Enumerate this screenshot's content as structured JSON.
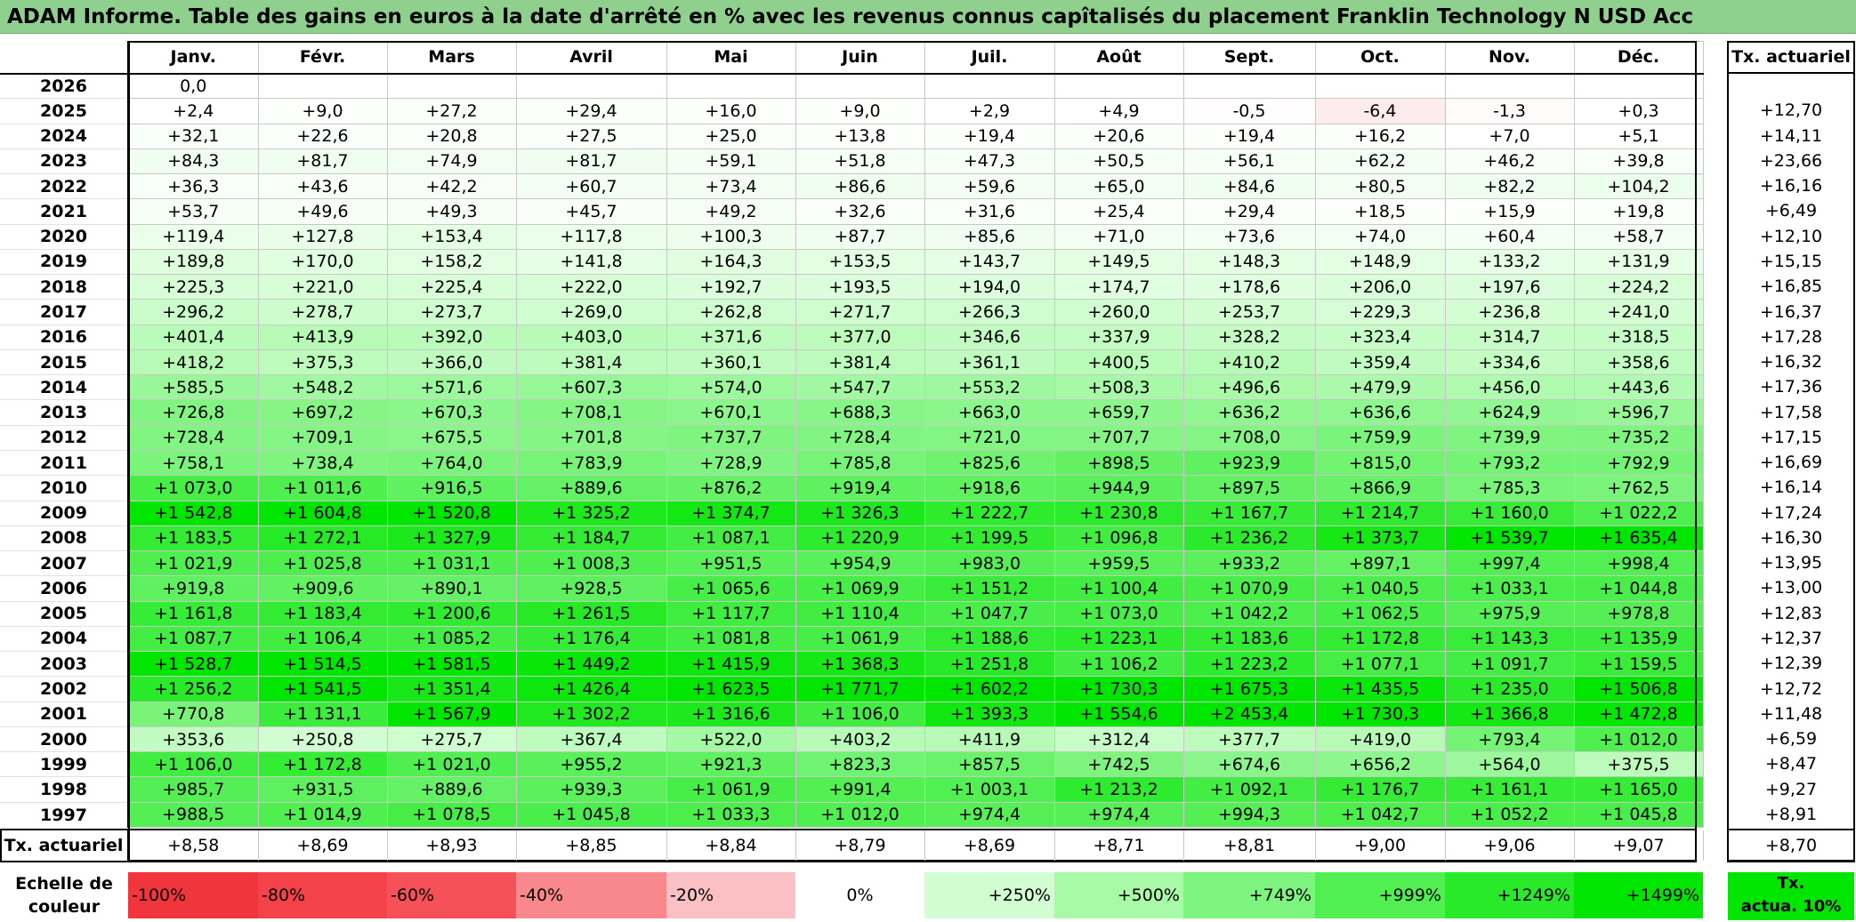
{
  "title": "ADAM Informe. Table des gains en euros à la date d'arrêté en % avec les revenus connus capîtalisés du placement Franklin Technology N USD Acc",
  "chart_data": {
    "type": "table",
    "title": "ADAM Informe. Table des gains en euros à la date d'arrêté en % avec les revenus connus capîtalisés du placement Franklin Technology N USD Acc",
    "columns": [
      "Janv.",
      "Févr.",
      "Mars",
      "Avril",
      "Mai",
      "Juin",
      "Juil.",
      "Août",
      "Sept.",
      "Oct.",
      "Nov.",
      "Déc."
    ],
    "rate_header": "Tx. actuariel",
    "rows": [
      {
        "year": "2026",
        "values": [
          "0,0",
          "",
          "",
          "",
          "",
          "",
          "",
          "",
          "",
          "",
          "",
          ""
        ],
        "num": [
          0,
          null,
          null,
          null,
          null,
          null,
          null,
          null,
          null,
          null,
          null,
          null
        ],
        "rate": ""
      },
      {
        "year": "2025",
        "values": [
          "+2,4",
          "+9,0",
          "+27,2",
          "+29,4",
          "+16,0",
          "+9,0",
          "+2,9",
          "+4,9",
          "-0,5",
          "-6,4",
          "-1,3",
          "+0,3"
        ],
        "num": [
          2.4,
          9.0,
          27.2,
          29.4,
          16.0,
          9.0,
          2.9,
          4.9,
          -0.5,
          -6.4,
          -1.3,
          0.3
        ],
        "rate": "+12,70"
      },
      {
        "year": "2024",
        "values": [
          "+32,1",
          "+22,6",
          "+20,8",
          "+27,5",
          "+25,0",
          "+13,8",
          "+19,4",
          "+20,6",
          "+19,4",
          "+16,2",
          "+7,0",
          "+5,1"
        ],
        "num": [
          32.1,
          22.6,
          20.8,
          27.5,
          25.0,
          13.8,
          19.4,
          20.6,
          19.4,
          16.2,
          7.0,
          5.1
        ],
        "rate": "+14,11"
      },
      {
        "year": "2023",
        "values": [
          "+84,3",
          "+81,7",
          "+74,9",
          "+81,7",
          "+59,1",
          "+51,8",
          "+47,3",
          "+50,5",
          "+56,1",
          "+62,2",
          "+46,2",
          "+39,8"
        ],
        "num": [
          84.3,
          81.7,
          74.9,
          81.7,
          59.1,
          51.8,
          47.3,
          50.5,
          56.1,
          62.2,
          46.2,
          39.8
        ],
        "rate": "+23,66"
      },
      {
        "year": "2022",
        "values": [
          "+36,3",
          "+43,6",
          "+42,2",
          "+60,7",
          "+73,4",
          "+86,6",
          "+59,6",
          "+65,0",
          "+84,6",
          "+80,5",
          "+82,2",
          "+104,2"
        ],
        "num": [
          36.3,
          43.6,
          42.2,
          60.7,
          73.4,
          86.6,
          59.6,
          65.0,
          84.6,
          80.5,
          82.2,
          104.2
        ],
        "rate": "+16,16"
      },
      {
        "year": "2021",
        "values": [
          "+53,7",
          "+49,6",
          "+49,3",
          "+45,7",
          "+49,2",
          "+32,6",
          "+31,6",
          "+25,4",
          "+29,4",
          "+18,5",
          "+15,9",
          "+19,8"
        ],
        "num": [
          53.7,
          49.6,
          49.3,
          45.7,
          49.2,
          32.6,
          31.6,
          25.4,
          29.4,
          18.5,
          15.9,
          19.8
        ],
        "rate": "+6,49"
      },
      {
        "year": "2020",
        "values": [
          "+119,4",
          "+127,8",
          "+153,4",
          "+117,8",
          "+100,3",
          "+87,7",
          "+85,6",
          "+71,0",
          "+73,6",
          "+74,0",
          "+60,4",
          "+58,7"
        ],
        "num": [
          119.4,
          127.8,
          153.4,
          117.8,
          100.3,
          87.7,
          85.6,
          71.0,
          73.6,
          74.0,
          60.4,
          58.7
        ],
        "rate": "+12,10"
      },
      {
        "year": "2019",
        "values": [
          "+189,8",
          "+170,0",
          "+158,2",
          "+141,8",
          "+164,3",
          "+153,5",
          "+143,7",
          "+149,5",
          "+148,3",
          "+148,9",
          "+133,2",
          "+131,9"
        ],
        "num": [
          189.8,
          170.0,
          158.2,
          141.8,
          164.3,
          153.5,
          143.7,
          149.5,
          148.3,
          148.9,
          133.2,
          131.9
        ],
        "rate": "+15,15"
      },
      {
        "year": "2018",
        "values": [
          "+225,3",
          "+221,0",
          "+225,4",
          "+222,0",
          "+192,7",
          "+193,5",
          "+194,0",
          "+174,7",
          "+178,6",
          "+206,0",
          "+197,6",
          "+224,2"
        ],
        "num": [
          225.3,
          221.0,
          225.4,
          222.0,
          192.7,
          193.5,
          194.0,
          174.7,
          178.6,
          206.0,
          197.6,
          224.2
        ],
        "rate": "+16,85"
      },
      {
        "year": "2017",
        "values": [
          "+296,2",
          "+278,7",
          "+273,7",
          "+269,0",
          "+262,8",
          "+271,7",
          "+266,3",
          "+260,0",
          "+253,7",
          "+229,3",
          "+236,8",
          "+241,0"
        ],
        "num": [
          296.2,
          278.7,
          273.7,
          269.0,
          262.8,
          271.7,
          266.3,
          260.0,
          253.7,
          229.3,
          236.8,
          241.0
        ],
        "rate": "+16,37"
      },
      {
        "year": "2016",
        "values": [
          "+401,4",
          "+413,9",
          "+392,0",
          "+403,0",
          "+371,6",
          "+377,0",
          "+346,6",
          "+337,9",
          "+328,2",
          "+323,4",
          "+314,7",
          "+318,5"
        ],
        "num": [
          401.4,
          413.9,
          392.0,
          403.0,
          371.6,
          377.0,
          346.6,
          337.9,
          328.2,
          323.4,
          314.7,
          318.5
        ],
        "rate": "+17,28"
      },
      {
        "year": "2015",
        "values": [
          "+418,2",
          "+375,3",
          "+366,0",
          "+381,4",
          "+360,1",
          "+381,4",
          "+361,1",
          "+400,5",
          "+410,2",
          "+359,4",
          "+334,6",
          "+358,6"
        ],
        "num": [
          418.2,
          375.3,
          366.0,
          381.4,
          360.1,
          381.4,
          361.1,
          400.5,
          410.2,
          359.4,
          334.6,
          358.6
        ],
        "rate": "+16,32"
      },
      {
        "year": "2014",
        "values": [
          "+585,5",
          "+548,2",
          "+571,6",
          "+607,3",
          "+574,0",
          "+547,7",
          "+553,2",
          "+508,3",
          "+496,6",
          "+479,9",
          "+456,0",
          "+443,6"
        ],
        "num": [
          585.5,
          548.2,
          571.6,
          607.3,
          574.0,
          547.7,
          553.2,
          508.3,
          496.6,
          479.9,
          456.0,
          443.6
        ],
        "rate": "+17,36"
      },
      {
        "year": "2013",
        "values": [
          "+726,8",
          "+697,2",
          "+670,3",
          "+708,1",
          "+670,1",
          "+688,3",
          "+663,0",
          "+659,7",
          "+636,2",
          "+636,6",
          "+624,9",
          "+596,7"
        ],
        "num": [
          726.8,
          697.2,
          670.3,
          708.1,
          670.1,
          688.3,
          663.0,
          659.7,
          636.2,
          636.6,
          624.9,
          596.7
        ],
        "rate": "+17,58"
      },
      {
        "year": "2012",
        "values": [
          "+728,4",
          "+709,1",
          "+675,5",
          "+701,8",
          "+737,7",
          "+728,4",
          "+721,0",
          "+707,7",
          "+708,0",
          "+759,9",
          "+739,9",
          "+735,2"
        ],
        "num": [
          728.4,
          709.1,
          675.5,
          701.8,
          737.7,
          728.4,
          721.0,
          707.7,
          708.0,
          759.9,
          739.9,
          735.2
        ],
        "rate": "+17,15"
      },
      {
        "year": "2011",
        "values": [
          "+758,1",
          "+738,4",
          "+764,0",
          "+783,9",
          "+728,9",
          "+785,8",
          "+825,6",
          "+898,5",
          "+923,9",
          "+815,0",
          "+793,2",
          "+792,9"
        ],
        "num": [
          758.1,
          738.4,
          764.0,
          783.9,
          728.9,
          785.8,
          825.6,
          898.5,
          923.9,
          815.0,
          793.2,
          792.9
        ],
        "rate": "+16,69"
      },
      {
        "year": "2010",
        "values": [
          "+1 073,0",
          "+1 011,6",
          "+916,5",
          "+889,6",
          "+876,2",
          "+919,4",
          "+918,6",
          "+944,9",
          "+897,5",
          "+866,9",
          "+785,3",
          "+762,5"
        ],
        "num": [
          1073.0,
          1011.6,
          916.5,
          889.6,
          876.2,
          919.4,
          918.6,
          944.9,
          897.5,
          866.9,
          785.3,
          762.5
        ],
        "rate": "+16,14"
      },
      {
        "year": "2009",
        "values": [
          "+1 542,8",
          "+1 604,8",
          "+1 520,8",
          "+1 325,2",
          "+1 374,7",
          "+1 326,3",
          "+1 222,7",
          "+1 230,8",
          "+1 167,7",
          "+1 214,7",
          "+1 160,0",
          "+1 022,2"
        ],
        "num": [
          1542.8,
          1604.8,
          1520.8,
          1325.2,
          1374.7,
          1326.3,
          1222.7,
          1230.8,
          1167.7,
          1214.7,
          1160.0,
          1022.2
        ],
        "rate": "+17,24"
      },
      {
        "year": "2008",
        "values": [
          "+1 183,5",
          "+1 272,1",
          "+1 327,9",
          "+1 184,7",
          "+1 087,1",
          "+1 220,9",
          "+1 199,5",
          "+1 096,8",
          "+1 236,2",
          "+1 373,7",
          "+1 539,7",
          "+1 635,4"
        ],
        "num": [
          1183.5,
          1272.1,
          1327.9,
          1184.7,
          1087.1,
          1220.9,
          1199.5,
          1096.8,
          1236.2,
          1373.7,
          1539.7,
          1635.4
        ],
        "rate": "+16,30"
      },
      {
        "year": "2007",
        "values": [
          "+1 021,9",
          "+1 025,8",
          "+1 031,1",
          "+1 008,3",
          "+951,5",
          "+954,9",
          "+983,0",
          "+959,5",
          "+933,2",
          "+897,1",
          "+997,4",
          "+998,4"
        ],
        "num": [
          1021.9,
          1025.8,
          1031.1,
          1008.3,
          951.5,
          954.9,
          983.0,
          959.5,
          933.2,
          897.1,
          997.4,
          998.4
        ],
        "rate": "+13,95"
      },
      {
        "year": "2006",
        "values": [
          "+919,8",
          "+909,6",
          "+890,1",
          "+928,5",
          "+1 065,6",
          "+1 069,9",
          "+1 151,2",
          "+1 100,4",
          "+1 070,9",
          "+1 040,5",
          "+1 033,1",
          "+1 044,8"
        ],
        "num": [
          919.8,
          909.6,
          890.1,
          928.5,
          1065.6,
          1069.9,
          1151.2,
          1100.4,
          1070.9,
          1040.5,
          1033.1,
          1044.8
        ],
        "rate": "+13,00"
      },
      {
        "year": "2005",
        "values": [
          "+1 161,8",
          "+1 183,4",
          "+1 200,6",
          "+1 261,5",
          "+1 117,7",
          "+1 110,4",
          "+1 047,7",
          "+1 073,0",
          "+1 042,2",
          "+1 062,5",
          "+975,9",
          "+978,8"
        ],
        "num": [
          1161.8,
          1183.4,
          1200.6,
          1261.5,
          1117.7,
          1110.4,
          1047.7,
          1073.0,
          1042.2,
          1062.5,
          975.9,
          978.8
        ],
        "rate": "+12,83"
      },
      {
        "year": "2004",
        "values": [
          "+1 087,7",
          "+1 106,4",
          "+1 085,2",
          "+1 176,4",
          "+1 081,8",
          "+1 061,9",
          "+1 188,6",
          "+1 223,1",
          "+1 183,6",
          "+1 172,8",
          "+1 143,3",
          "+1 135,9"
        ],
        "num": [
          1087.7,
          1106.4,
          1085.2,
          1176.4,
          1081.8,
          1061.9,
          1188.6,
          1223.1,
          1183.6,
          1172.8,
          1143.3,
          1135.9
        ],
        "rate": "+12,37"
      },
      {
        "year": "2003",
        "values": [
          "+1 528,7",
          "+1 514,5",
          "+1 581,5",
          "+1 449,2",
          "+1 415,9",
          "+1 368,3",
          "+1 251,8",
          "+1 106,2",
          "+1 223,2",
          "+1 077,1",
          "+1 091,7",
          "+1 159,5"
        ],
        "num": [
          1528.7,
          1514.5,
          1581.5,
          1449.2,
          1415.9,
          1368.3,
          1251.8,
          1106.2,
          1223.2,
          1077.1,
          1091.7,
          1159.5
        ],
        "rate": "+12,39"
      },
      {
        "year": "2002",
        "values": [
          "+1 256,2",
          "+1 541,5",
          "+1 351,4",
          "+1 426,4",
          "+1 623,5",
          "+1 771,7",
          "+1 602,2",
          "+1 730,3",
          "+1 675,3",
          "+1 435,5",
          "+1 235,0",
          "+1 506,8"
        ],
        "num": [
          1256.2,
          1541.5,
          1351.4,
          1426.4,
          1623.5,
          1771.7,
          1602.2,
          1730.3,
          1675.3,
          1435.5,
          1235.0,
          1506.8
        ],
        "rate": "+12,72"
      },
      {
        "year": "2001",
        "values": [
          "+770,8",
          "+1 131,1",
          "+1 567,9",
          "+1 302,2",
          "+1 316,6",
          "+1 106,0",
          "+1 393,3",
          "+1 554,6",
          "+2 453,4",
          "+1 730,3",
          "+1 366,8",
          "+1 472,8"
        ],
        "num": [
          770.8,
          1131.1,
          1567.9,
          1302.2,
          1316.6,
          1106.0,
          1393.3,
          1554.6,
          2453.4,
          1730.3,
          1366.8,
          1472.8
        ],
        "rate": "+11,48"
      },
      {
        "year": "2000",
        "values": [
          "+353,6",
          "+250,8",
          "+275,7",
          "+367,4",
          "+522,0",
          "+403,2",
          "+411,9",
          "+312,4",
          "+377,7",
          "+419,0",
          "+793,4",
          "+1 012,0"
        ],
        "num": [
          353.6,
          250.8,
          275.7,
          367.4,
          522.0,
          403.2,
          411.9,
          312.4,
          377.7,
          419.0,
          793.4,
          1012.0
        ],
        "rate": "+6,59"
      },
      {
        "year": "1999",
        "values": [
          "+1 106,0",
          "+1 172,8",
          "+1 021,0",
          "+955,2",
          "+921,3",
          "+823,3",
          "+857,5",
          "+742,5",
          "+674,6",
          "+656,2",
          "+564,0",
          "+375,5"
        ],
        "num": [
          1106.0,
          1172.8,
          1021.0,
          955.2,
          921.3,
          823.3,
          857.5,
          742.5,
          674.6,
          656.2,
          564.0,
          375.5
        ],
        "rate": "+8,47"
      },
      {
        "year": "1998",
        "values": [
          "+985,7",
          "+931,5",
          "+889,6",
          "+939,3",
          "+1 061,9",
          "+991,4",
          "+1 003,1",
          "+1 213,2",
          "+1 092,1",
          "+1 176,7",
          "+1 161,1",
          "+1 165,0"
        ],
        "num": [
          985.7,
          931.5,
          889.6,
          939.3,
          1061.9,
          991.4,
          1003.1,
          1213.2,
          1092.1,
          1176.7,
          1161.1,
          1165.0
        ],
        "rate": "+9,27"
      },
      {
        "year": "1997",
        "values": [
          "+988,5",
          "+1 014,9",
          "+1 078,5",
          "+1 045,8",
          "+1 033,3",
          "+1 012,0",
          "+974,4",
          "+974,4",
          "+994,3",
          "+1 042,7",
          "+1 052,2",
          "+1 045,8"
        ],
        "num": [
          988.5,
          1014.9,
          1078.5,
          1045.8,
          1033.3,
          1012.0,
          974.4,
          974.4,
          994.3,
          1042.7,
          1052.2,
          1045.8
        ],
        "rate": "+8,91"
      }
    ],
    "rate_row": {
      "label": "Tx. actuariel",
      "values": [
        "+8,58",
        "+8,69",
        "+8,93",
        "+8,85",
        "+8,84",
        "+8,79",
        "+8,69",
        "+8,71",
        "+8,81",
        "+9,00",
        "+9,06",
        "+9,07"
      ],
      "total": "+8,70"
    },
    "color_scale": {
      "label_line1": "Echelle de",
      "label_line2": "couleur",
      "stops": [
        {
          "label": "-100%",
          "color": "#f0363c"
        },
        {
          "label": "-80%",
          "color": "#f3424a"
        },
        {
          "label": "-60%",
          "color": "#f65058"
        },
        {
          "label": "-40%",
          "color": "#f8888c"
        },
        {
          "label": "-20%",
          "color": "#fbc0c3"
        },
        {
          "label": "0%",
          "color": "#ffffff"
        },
        {
          "label": "+250%",
          "color": "#d2fdd2"
        },
        {
          "label": "+500%",
          "color": "#a8f9a8"
        },
        {
          "label": "+749%",
          "color": "#7df47d"
        },
        {
          "label": "+999%",
          "color": "#52ef52"
        },
        {
          "label": "+1249%",
          "color": "#29ea29"
        },
        {
          "label": "+1499%",
          "color": "#00e600"
        }
      ],
      "right_line1": "Tx.",
      "right_line2": "actua. 10%",
      "right_color": "#00e600"
    }
  }
}
